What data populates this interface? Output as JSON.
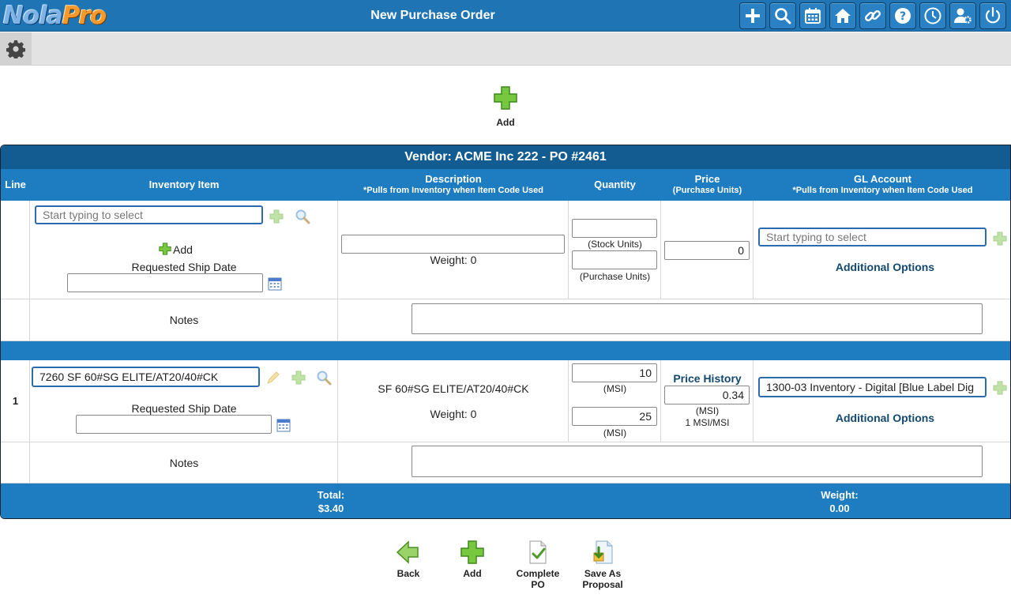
{
  "app": {
    "logo_part1": "Nola",
    "logo_part2": "Pro",
    "page_title": "New Purchase Order"
  },
  "top_icons": [
    "add-icon",
    "search-icon",
    "calendar-icon",
    "home-icon",
    "link-icon",
    "help-icon",
    "clock-icon",
    "user-settings-icon",
    "power-icon"
  ],
  "top_add": {
    "label": "Add"
  },
  "po": {
    "header": "Vendor: ACME Inc 222 - PO #2461",
    "columns": {
      "line": "Line",
      "item": "Inventory Item",
      "desc": "Description",
      "desc_note": "*Pulls from Inventory when Item Code Used",
      "qty": "Quantity",
      "price": "Price",
      "price_note": "(Purchase Units)",
      "gl": "GL Account",
      "gl_note": "*Pulls from Inventory when Item Code Used"
    },
    "new_row": {
      "item_placeholder": "Start typing to select",
      "add_label": "Add",
      "ship_date_label": "Requested Ship Date",
      "ship_date_value": "",
      "desc_value": "",
      "weight": "Weight: 0",
      "stock_qty": "",
      "stock_units": "(Stock Units)",
      "purchase_qty": "",
      "purchase_units": "(Purchase Units)",
      "price": "0",
      "gl_placeholder": "Start typing to select",
      "additional_options": "Additional Options",
      "notes_label": "Notes"
    },
    "line_row": {
      "line_no": "1",
      "item_value": "7260 SF 60#SG ELITE/AT20/40#CK",
      "ship_date_label": "Requested Ship Date",
      "ship_date_value": "",
      "description": "SF 60#SG ELITE/AT20/40#CK",
      "weight": "Weight: 0",
      "qty_stock": "10",
      "qty_stock_unit": "(MSI)",
      "qty_purchase": "25",
      "qty_purchase_unit": "(MSI)",
      "price_history": "Price History",
      "price": "0.34",
      "price_unit": "(MSI)",
      "conversion": "1 MSI/MSI",
      "gl_value": "1300-03 Inventory - Digital [Blue Label Dig",
      "additional_options": "Additional Options",
      "notes_label": "Notes"
    },
    "totals": {
      "total_label": "Total:",
      "total_value": "$3.40",
      "weight_label": "Weight:",
      "weight_value": "0.00"
    }
  },
  "bottom_actions": {
    "back": "Back",
    "add": "Add",
    "complete_line1": "Complete",
    "complete_line2": "PO",
    "save_line1": "Save As",
    "save_line2": "Proposal"
  },
  "colors": {
    "topbar": "#1f74b3",
    "header_dark": "#135c91",
    "header": "#1e7cc0",
    "accent_green": "#7ac943"
  }
}
